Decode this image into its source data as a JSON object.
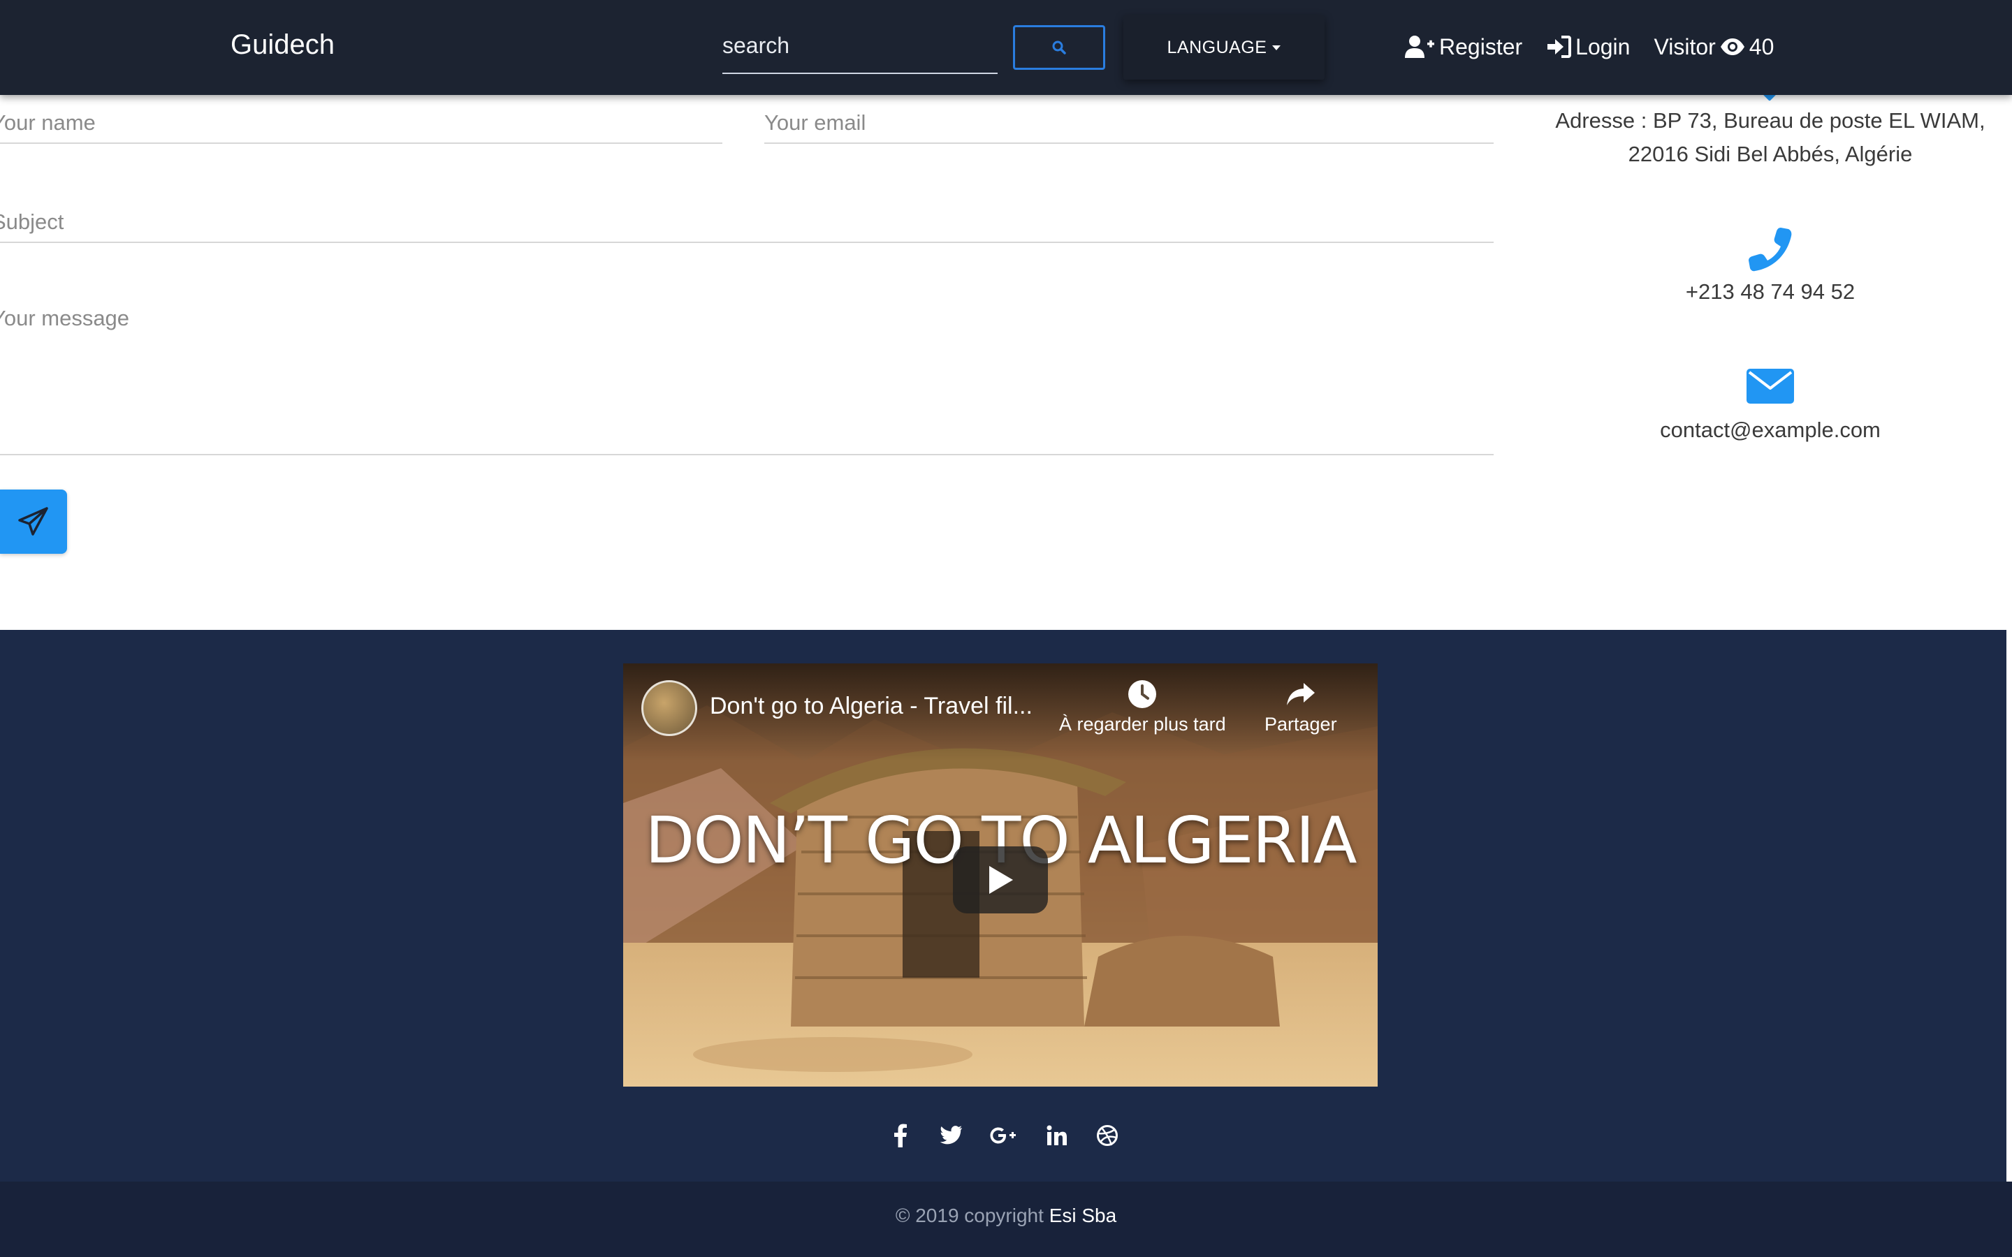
{
  "navbar": {
    "brand": "Guidech",
    "search_placeholder": "search",
    "search_icon": "search-icon",
    "language_label": "LANGUAGE",
    "register_label": "Register",
    "login_label": "Login",
    "visitor_label": "Visitor",
    "visitor_count": "40"
  },
  "contact_form": {
    "name_placeholder": "Your name",
    "email_placeholder": "Your email",
    "subject_placeholder": "Subject",
    "message_placeholder": "Your message",
    "send_icon": "paper-plane-icon"
  },
  "contact_info": {
    "address_line1": "Adresse : BP 73, Bureau de poste EL WIAM,",
    "address_line2": "22016 Sidi Bel Abbés, Algérie",
    "phone": "+213 48 74 94 52",
    "email": "contact@example.com",
    "accent_color": "#2196f3"
  },
  "video": {
    "title": "Don't go to Algeria - Travel fil...",
    "watch_later_label": "À regarder plus tard",
    "share_label": "Partager",
    "headline": "DON’T GO TO ALGERIA"
  },
  "socials": [
    "facebook-icon",
    "twitter-icon",
    "google-plus-icon",
    "linkedin-icon",
    "dribbble-icon"
  ],
  "footer": {
    "copyright_prefix": "© 2019 copyright",
    "copyright_owner": "Esi Sba"
  }
}
